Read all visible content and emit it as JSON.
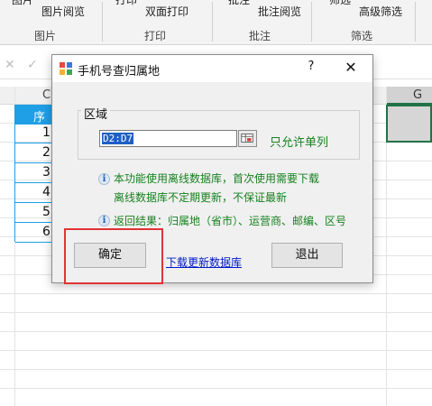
{
  "ribbon": {
    "row1": {
      "item_a": "图片",
      "picture_browse": "图片阅览",
      "print_item": "打印",
      "duplex_print": "双面打印",
      "annotate": "批注",
      "annotate_browse": "批注阅览",
      "filter": "筛选",
      "advanced_filter": "高级筛选"
    },
    "groups": {
      "picture": "图片",
      "print": "打印",
      "annotation": "批注",
      "filter": "筛选"
    }
  },
  "sheet": {
    "col_c": "C",
    "col_g": "G",
    "header_cell": "序",
    "row_numbers": [
      "1",
      "2",
      "3",
      "4",
      "5",
      "6"
    ]
  },
  "dialog": {
    "title": "手机号查归属地",
    "help": "?",
    "close": "✕",
    "group_label": "区域",
    "range_value": "D2:D7",
    "only_single_col": "只允许单列",
    "info1_line1": "本功能使用离线数据库，首次使用需要下载",
    "info1_line2": "离线数据库不定期更新，不保证最新",
    "info2": "返回结果：归属地（省市）、运营商、邮编、区号",
    "ok": "确定",
    "download_link": "下载更新数据库",
    "exit": "退出"
  },
  "colors": {
    "accent_blue": "#1e9fe6",
    "green_text": "#16811f",
    "link": "#0018c8",
    "highlight": "#e03535"
  }
}
